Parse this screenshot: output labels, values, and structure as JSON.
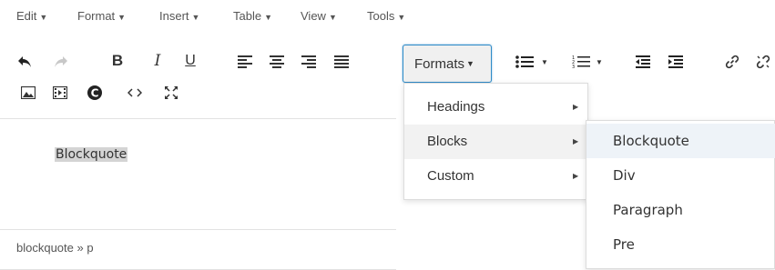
{
  "menubar": {
    "items": [
      {
        "label": "Edit"
      },
      {
        "label": "Format"
      },
      {
        "label": "Insert"
      },
      {
        "label": "Table"
      },
      {
        "label": "View"
      },
      {
        "label": "Tools"
      }
    ]
  },
  "toolbar": {
    "bold_label": "B",
    "italic_label": "I",
    "underline_label": "U",
    "formats_label": "Formats",
    "icons": [
      "undo-icon",
      "redo-icon",
      "bold-icon",
      "italic-icon",
      "underline-icon",
      "align-left-icon",
      "align-center-icon",
      "align-right-icon",
      "align-justify-icon",
      "bullet-list-icon",
      "numbered-list-icon",
      "outdent-icon",
      "indent-icon",
      "link-icon",
      "unlink-icon",
      "image-icon",
      "media-icon",
      "copyright-icon",
      "code-icon",
      "fullscreen-icon"
    ]
  },
  "editor": {
    "content": "Blockquote"
  },
  "statusbar": {
    "path": "blockquote » p"
  },
  "formats_menu": {
    "items": [
      {
        "label": "Headings"
      },
      {
        "label": "Blocks"
      },
      {
        "label": "Custom"
      }
    ],
    "active": "Blocks"
  },
  "blocks_submenu": {
    "items": [
      {
        "label": "Blockquote"
      },
      {
        "label": "Div"
      },
      {
        "label": "Paragraph"
      },
      {
        "label": "Pre"
      }
    ],
    "active": "Blockquote"
  },
  "colors": {
    "focus_border": "#2d8ac7",
    "selection_bg": "#d4d4d4",
    "active_menu_bg": "#f2f2f2"
  }
}
